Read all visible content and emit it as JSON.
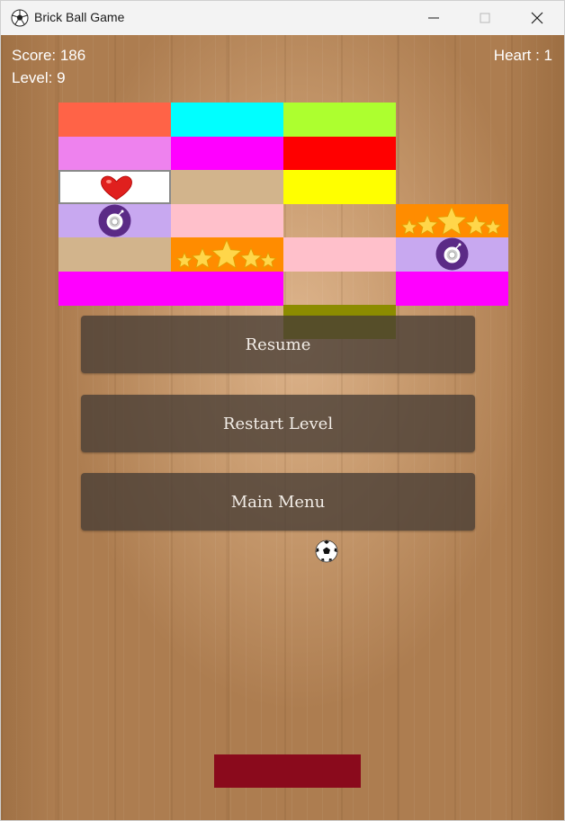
{
  "window": {
    "title": "Brick Ball Game",
    "controls": [
      "minimize",
      "maximize",
      "close"
    ]
  },
  "hud": {
    "score_text": "Score: 186",
    "level_text": "Level: 9",
    "hearts_text": "Heart : 1"
  },
  "bricks": [
    {
      "row": 0,
      "col": 0,
      "color": "#ff6347",
      "item": null
    },
    {
      "row": 0,
      "col": 1,
      "color": "#00ffff",
      "item": null
    },
    {
      "row": 0,
      "col": 2,
      "color": "#adff2f",
      "item": null
    },
    {
      "row": 1,
      "col": 0,
      "color": "#ee82ee",
      "item": null
    },
    {
      "row": 1,
      "col": 1,
      "color": "#ff00ff",
      "item": null
    },
    {
      "row": 1,
      "col": 2,
      "color": "#ff0000",
      "item": null
    },
    {
      "row": 2,
      "col": 0,
      "color": "#ffffff",
      "item": "heart-icon"
    },
    {
      "row": 2,
      "col": 1,
      "color": "#d2b48c",
      "item": null
    },
    {
      "row": 2,
      "col": 2,
      "color": "#ffff00",
      "item": null
    },
    {
      "row": 3,
      "col": 0,
      "color": "#c8a8f0",
      "item": "bomb-icon"
    },
    {
      "row": 3,
      "col": 1,
      "color": "#ffc0cb",
      "item": null
    },
    {
      "row": 3,
      "col": 3,
      "color": "#ff8c00",
      "item": "stars-icon"
    },
    {
      "row": 4,
      "col": 0,
      "color": "#d2b48c",
      "item": null
    },
    {
      "row": 4,
      "col": 1,
      "color": "#ff8c00",
      "item": "stars-icon"
    },
    {
      "row": 4,
      "col": 2,
      "color": "#ffc0cb",
      "item": null
    },
    {
      "row": 4,
      "col": 3,
      "color": "#c8a8f0",
      "item": "bomb-icon"
    },
    {
      "row": 5,
      "col": 0,
      "color": "#ff00ff",
      "item": null
    },
    {
      "row": 5,
      "col": 1,
      "color": "#ff00ff",
      "item": null
    },
    {
      "row": 5,
      "col": 3,
      "color": "#ff00ff",
      "item": null
    },
    {
      "row": 6,
      "col": 2,
      "color": "#ffff00",
      "item": null
    }
  ],
  "pause_menu": {
    "resume_label": "Resume",
    "restart_label": "Restart Level",
    "main_menu_label": "Main Menu"
  },
  "colors": {
    "paddle": "#8a0a1c",
    "menu_button": "#463c34"
  }
}
